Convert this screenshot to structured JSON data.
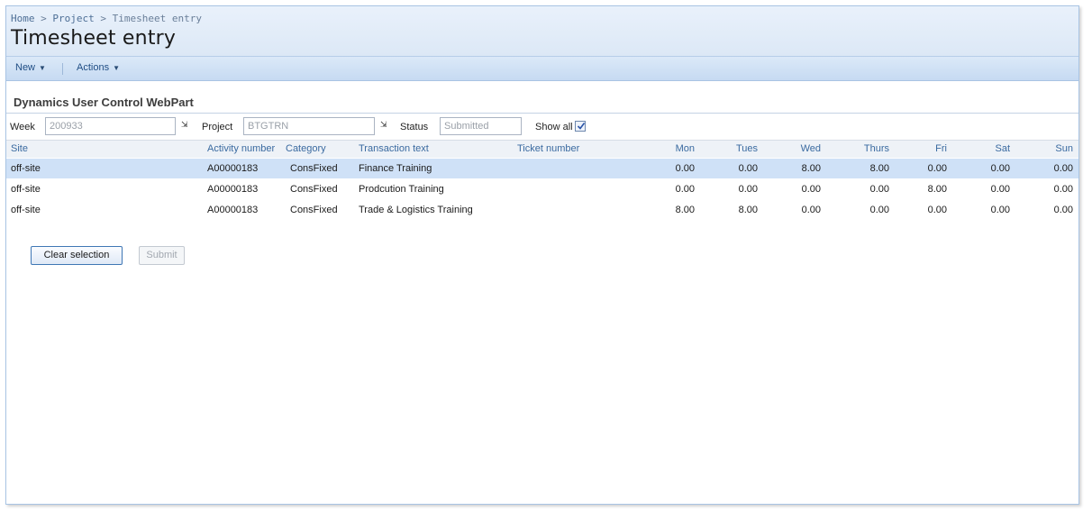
{
  "breadcrumb": {
    "items": [
      "Home",
      "Project",
      "Timesheet entry"
    ],
    "separator": ">"
  },
  "page": {
    "title": "Timesheet entry"
  },
  "toolbar": {
    "new_label": "New",
    "actions_label": "Actions"
  },
  "webpart": {
    "title": "Dynamics User Control WebPart"
  },
  "filters": {
    "week_label": "Week",
    "week_value": "200933",
    "project_label": "Project",
    "project_value": "BTGTRN",
    "status_label": "Status",
    "status_value": "Submitted",
    "show_all_label": "Show all",
    "show_all_checked": true
  },
  "grid": {
    "columns": {
      "site": "Site",
      "activity": "Activity number",
      "category": "Category",
      "transaction": "Transaction text",
      "ticket": "Ticket number",
      "mon": "Mon",
      "tues": "Tues",
      "wed": "Wed",
      "thurs": "Thurs",
      "fri": "Fri",
      "sat": "Sat",
      "sun": "Sun"
    },
    "rows": [
      {
        "site": "off-site",
        "activity": "A00000183",
        "category": "ConsFixed",
        "transaction": "Finance Training",
        "ticket": "",
        "mon": "0.00",
        "tues": "0.00",
        "wed": "8.00",
        "thurs": "8.00",
        "fri": "0.00",
        "sat": "0.00",
        "sun": "0.00"
      },
      {
        "site": "off-site",
        "activity": "A00000183",
        "category": "ConsFixed",
        "transaction": "Prodcution Training",
        "ticket": "",
        "mon": "0.00",
        "tues": "0.00",
        "wed": "0.00",
        "thurs": "0.00",
        "fri": "8.00",
        "sat": "0.00",
        "sun": "0.00"
      },
      {
        "site": "off-site",
        "activity": "A00000183",
        "category": "ConsFixed",
        "transaction": "Trade & Logistics Training",
        "ticket": "",
        "mon": "8.00",
        "tues": "8.00",
        "wed": "0.00",
        "thurs": "0.00",
        "fri": "0.00",
        "sat": "0.00",
        "sun": "0.00"
      }
    ],
    "selected_row": 0
  },
  "buttons": {
    "clear_selection": "Clear selection",
    "submit": "Submit"
  },
  "colors": {
    "header_bg": "#dce8f6",
    "toolbar_bg": "#c6daf2",
    "link": "#3a6aa0",
    "selected_row": "#cfe1f7"
  }
}
